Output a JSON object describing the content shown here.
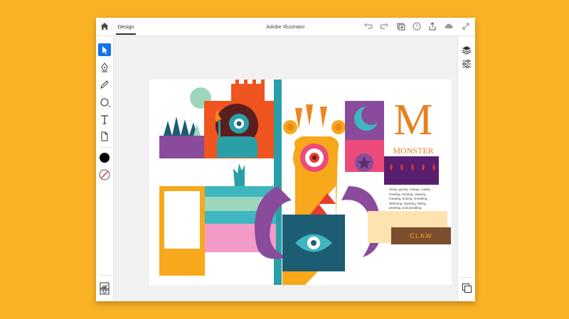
{
  "window": {
    "title": "Adobe Illustrator"
  },
  "tabs": [
    {
      "label": "Design"
    }
  ],
  "artwork": {
    "big_letter": "M",
    "headline": "MONSTER",
    "body_text": [
      "Scary, gooey, creepy, crawly,",
      "howling, hooting, clawing,",
      "mauling, booing, sneaking,",
      "slithering, ducking, hiding,",
      "peeking, and prodding."
    ],
    "claw_label": "CLAW"
  },
  "colors": {
    "background": "#F9B225",
    "accent": "#1473E6",
    "purple": "#8A4B9C",
    "orange": "#F0851F",
    "teal": "#1C5D73",
    "red": "#E63B2E",
    "brown": "#7B4E2E"
  },
  "icons": {
    "topbar": [
      "home-icon",
      "undo-icon",
      "redo-icon",
      "export-layers-icon",
      "help-icon",
      "share-icon",
      "cloud-icon",
      "fullscreen-icon"
    ],
    "tools": [
      "selection-tool-icon",
      "pen-tool-icon",
      "pencil-tool-icon",
      "shape-tool-icon",
      "type-tool-icon",
      "place-image-icon",
      "fill-color-icon",
      "stroke-color-icon",
      "camera-icon",
      "image-trace-icon"
    ],
    "right": [
      "layers-icon",
      "properties-icon",
      "artboards-icon"
    ]
  }
}
